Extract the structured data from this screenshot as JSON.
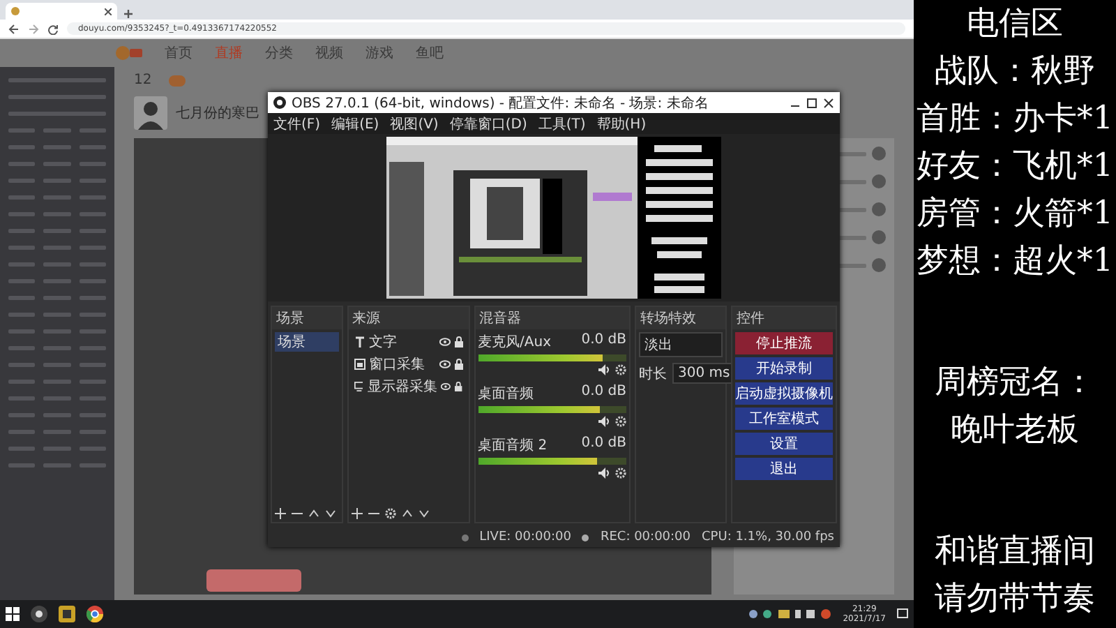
{
  "browser": {
    "url": "douyu.com/9353245?_t=0.4913367174220552"
  },
  "site": {
    "nav": [
      {
        "label": "首页",
        "selected": false
      },
      {
        "label": "直播",
        "selected": true
      },
      {
        "label": "分类",
        "selected": false
      },
      {
        "label": "视频",
        "selected": false
      },
      {
        "label": "游戏",
        "selected": false
      },
      {
        "label": "鱼吧",
        "selected": false
      }
    ],
    "follow_count": "12",
    "streamer_title": "七月份的寒巴"
  },
  "obs": {
    "title": "OBS 27.0.1 (64-bit, windows) - 配置文件: 未命名 - 场景: 未命名",
    "menu": [
      "文件(F)",
      "编辑(E)",
      "视图(V)",
      "停靠窗口(D)",
      "工具(T)",
      "帮助(H)"
    ],
    "scenes_header": "场景",
    "scenes": [
      {
        "label": "场景",
        "selected": true
      }
    ],
    "sources_header": "来源",
    "sources": [
      {
        "kind": "text",
        "label": "文字"
      },
      {
        "kind": "window",
        "label": "窗口采集"
      },
      {
        "kind": "display",
        "label": "显示器采集"
      }
    ],
    "mixer_header": "混音器",
    "channels": [
      {
        "name": "麦克风/Aux",
        "reading": "0.0 dB",
        "level": 0.84
      },
      {
        "name": "桌面音频",
        "reading": "0.0 dB",
        "level": 0.82
      },
      {
        "name": "桌面音频 2",
        "reading": "0.0 dB",
        "level": 0.8
      }
    ],
    "transitions_header": "转场特效",
    "transition": "淡出",
    "duration_label": "时长",
    "duration": "300 ms",
    "controls_header": "控件",
    "controls": [
      {
        "kind": "stop",
        "label": "停止推流"
      },
      {
        "kind": "normal",
        "label": "开始录制"
      },
      {
        "kind": "normal",
        "label": "启动虚拟摄像机"
      },
      {
        "kind": "normal",
        "label": "工作室模式"
      },
      {
        "kind": "normal",
        "label": "设置"
      },
      {
        "kind": "normal",
        "label": "退出"
      }
    ],
    "status": {
      "live": "LIVE: 00:00:00",
      "rec": "REC: 00:00:00",
      "cpu": "CPU: 1.1%, 30.00 fps"
    }
  },
  "panel": {
    "groups": [
      [
        "电信区",
        "战队：秋野",
        "首胜：办卡*1",
        "好友：飞机*1",
        "房管：火箭*1",
        "梦想：超火*1"
      ],
      [
        "周榜冠名：",
        "晚叶老板"
      ],
      [
        "和谐直播间",
        "请勿带节奏"
      ]
    ]
  },
  "taskbar": {
    "time": "21:29",
    "date": "2021/7/17"
  }
}
